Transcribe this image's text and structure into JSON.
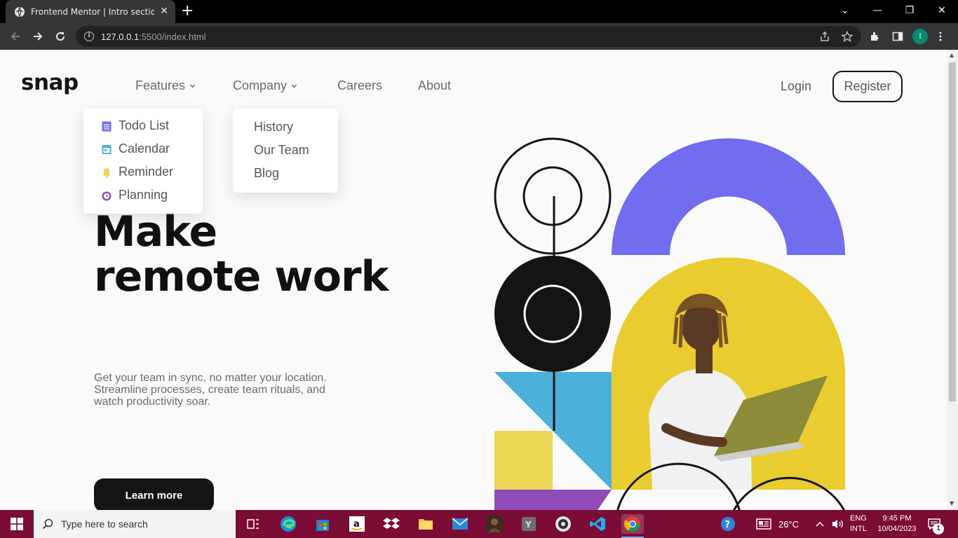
{
  "browser": {
    "tab_title": "Frontend Mentor | Intro section w",
    "url_host": "127.0.0.1",
    "url_rest": ":5500/index.html",
    "profile_initial": "I"
  },
  "page": {
    "logo": "snap",
    "nav": {
      "features": "Features",
      "company": "Company",
      "careers": "Careers",
      "about": "About"
    },
    "login": "Login",
    "register": "Register",
    "features_menu": [
      {
        "label": "Todo List",
        "icon": "todo-icon",
        "color": "#726cee"
      },
      {
        "label": "Calendar",
        "icon": "calendar-icon",
        "color": "#4bb1da"
      },
      {
        "label": "Reminder",
        "icon": "bell-icon",
        "color": "#edd556"
      },
      {
        "label": "Planning",
        "icon": "planning-icon",
        "color": "#8e4cb6"
      }
    ],
    "company_menu": [
      "History",
      "Our Team",
      "Blog"
    ],
    "hero_line1": "Make",
    "hero_line2": "remote work",
    "hero_text": "Get your team in sync, no matter your location. Streamline processes, create team rituals, and watch productivity soar.",
    "cta": "Learn more",
    "colors": {
      "purple": "#726cee",
      "yellow": "#e9cc2f",
      "blue": "#4bb1da",
      "ink": "#141414"
    }
  },
  "taskbar": {
    "search_placeholder": "Type here to search",
    "weather": "26°C",
    "lang1": "ENG",
    "lang2": "INTL",
    "time": "9:45 PM",
    "date": "10/04/2023",
    "notif_count": "1"
  }
}
